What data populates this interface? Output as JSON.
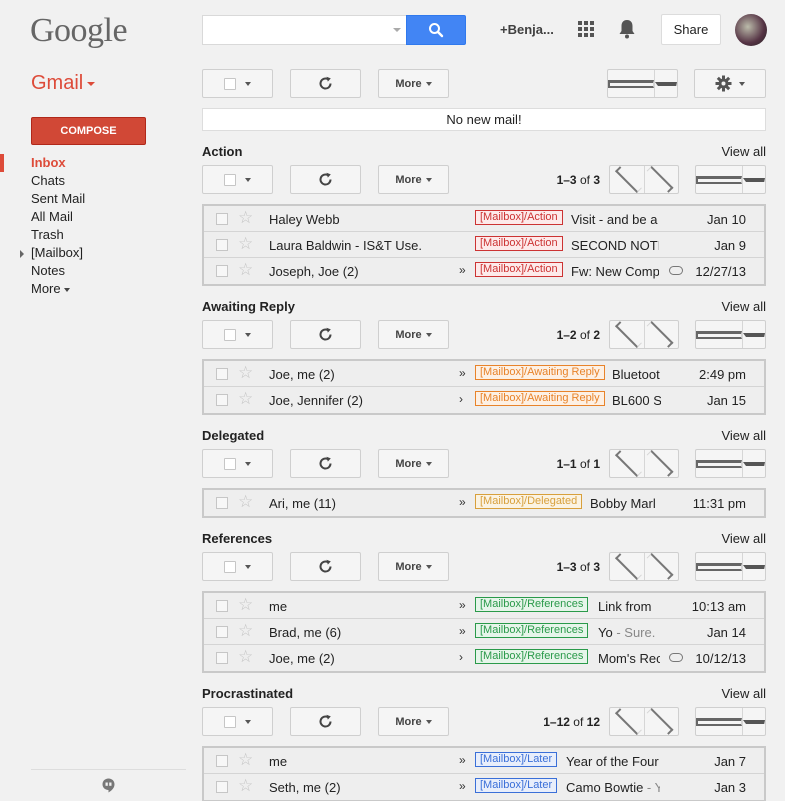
{
  "header": {
    "logo": "Google",
    "user_name": "+Benja...",
    "share_label": "Share"
  },
  "sidebar": {
    "app_label": "Gmail",
    "compose_label": "COMPOSE",
    "items": [
      {
        "label": "Inbox"
      },
      {
        "label": "Chats"
      },
      {
        "label": "Sent Mail"
      },
      {
        "label": "All Mail"
      },
      {
        "label": "Trash"
      },
      {
        "label": "[Mailbox]"
      },
      {
        "label": "Notes"
      },
      {
        "label": "More"
      }
    ]
  },
  "toolbar": {
    "more_label": "More"
  },
  "inbox": {
    "no_mail": "No new mail!"
  },
  "view_all": "View all",
  "sections": [
    {
      "title": "Action",
      "pager": {
        "range": "1–3",
        "of": "of",
        "total": "3"
      },
      "rows": [
        {
          "sender": "Haley Webb",
          "importance": "",
          "label": "[Mailbox]/Action",
          "subject": "Visit - and be a",
          "snippet": "",
          "attachment": false,
          "date": "Jan 10"
        },
        {
          "sender": "Laura Baldwin - IS&T Use.",
          "importance": "",
          "label": "[Mailbox]/Action",
          "subject": "SECOND NOTI",
          "snippet": "",
          "attachment": false,
          "date": "Jan 9"
        },
        {
          "sender": "Joseph, Joe (2)",
          "importance": "»",
          "label": "[Mailbox]/Action",
          "subject": "Fw: New Comp",
          "snippet": "",
          "attachment": true,
          "date": "12/27/13"
        }
      ]
    },
    {
      "title": "Awaiting Reply",
      "pager": {
        "range": "1–2",
        "of": "of",
        "total": "2"
      },
      "rows": [
        {
          "sender": "Joe, me (2)",
          "importance": "»",
          "label": "[Mailbox]/Awaiting Reply",
          "subject": "Bluetoot",
          "snippet": "",
          "attachment": false,
          "date": "2:49 pm"
        },
        {
          "sender": "Joe, Jennifer (2)",
          "importance": "›",
          "label": "[Mailbox]/Awaiting Reply",
          "subject": "BL600 S",
          "snippet": "",
          "attachment": false,
          "date": "Jan 15"
        }
      ]
    },
    {
      "title": "Delegated",
      "pager": {
        "range": "1–1",
        "of": "of",
        "total": "1"
      },
      "rows": [
        {
          "sender": "Ari, me (11)",
          "importance": "»",
          "label": "[Mailbox]/Delegated",
          "subject": "Bobby Marl",
          "snippet": "",
          "attachment": false,
          "date": "11:31 pm"
        }
      ]
    },
    {
      "title": "References",
      "pager": {
        "range": "1–3",
        "of": "of",
        "total": "3"
      },
      "rows": [
        {
          "sender": "me",
          "importance": "»",
          "label": "[Mailbox]/References",
          "subject": "Link from ",
          "snippet": "",
          "attachment": false,
          "date": "10:13 am"
        },
        {
          "sender": "Brad, me (6)",
          "importance": "»",
          "label": "[Mailbox]/References",
          "subject": "Yo",
          "snippet": " - Sure.",
          "attachment": false,
          "date": "Jan 14"
        },
        {
          "sender": "Joe, me (2)",
          "importance": "›",
          "label": "[Mailbox]/References",
          "subject": "Mom's Rec",
          "snippet": "",
          "attachment": true,
          "date": "10/12/13"
        }
      ]
    },
    {
      "title": "Procrastinated",
      "pager": {
        "range": "1–12",
        "of": "of",
        "total": "12"
      },
      "rows": [
        {
          "sender": "me",
          "importance": "»",
          "label": "[Mailbox]/Later",
          "subject": "Year of the Four",
          "snippet": "",
          "attachment": false,
          "date": "Jan 7"
        },
        {
          "sender": "Seth, me (2)",
          "importance": "»",
          "label": "[Mailbox]/Later",
          "subject": "Camo Bowtie",
          "snippet": " - Y",
          "attachment": false,
          "date": "Jan 3"
        }
      ]
    }
  ],
  "colors": {
    "brand_red": "#dd4b39",
    "search_blue": "#4285f4",
    "label_action": "#cc3333",
    "label_awaiting": "#e8832a",
    "label_delegated": "#d8a03c",
    "label_references": "#2a9a4a",
    "label_later": "#3a6fd8"
  },
  "icons": [
    "search-icon",
    "apps-grid-icon",
    "notifications-bell-icon",
    "settings-gear-icon",
    "refresh-icon",
    "hangouts-icon",
    "star-icon",
    "attachment-icon"
  ]
}
